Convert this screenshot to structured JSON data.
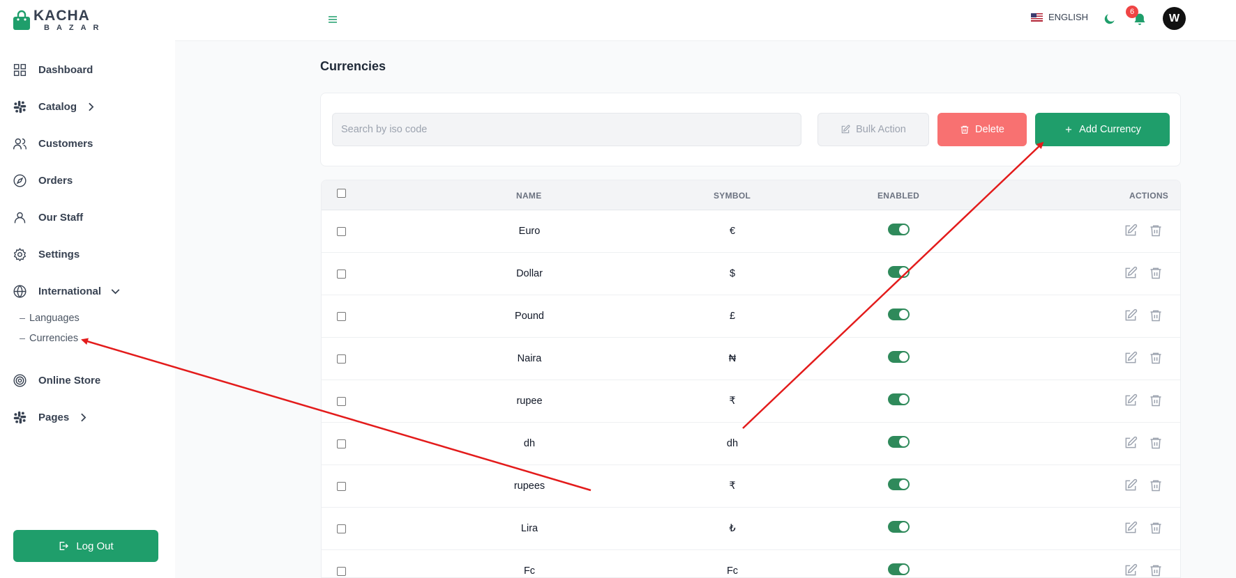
{
  "brand": {
    "top": "KACHA",
    "bottom": "BAZAR"
  },
  "sidebar": {
    "items": [
      {
        "label": "Dashboard",
        "icon": "grid-icon"
      },
      {
        "label": "Catalog",
        "icon": "slack-icon"
      },
      {
        "label": "Customers",
        "icon": "users-icon"
      },
      {
        "label": "Orders",
        "icon": "compass-icon"
      },
      {
        "label": "Our Staff",
        "icon": "user-icon"
      },
      {
        "label": "Settings",
        "icon": "gear-icon"
      },
      {
        "label": "International",
        "icon": "globe-icon"
      },
      {
        "label": "Online Store",
        "icon": "target-icon"
      },
      {
        "label": "Pages",
        "icon": "slack-icon"
      }
    ],
    "sub_items": [
      "Languages",
      "Currencies"
    ],
    "logout_label": "Log Out"
  },
  "header": {
    "language": "ENGLISH",
    "notification_count": "6",
    "avatar_initial": "W"
  },
  "page": {
    "title": "Currencies",
    "search_placeholder": "Search by iso code",
    "bulk_action_label": "Bulk Action",
    "delete_label": "Delete",
    "add_label": "Add Currency"
  },
  "table": {
    "columns": [
      "NAME",
      "SYMBOL",
      "ENABLED",
      "ACTIONS"
    ],
    "rows": [
      {
        "name": "Euro",
        "symbol": "€",
        "enabled": true
      },
      {
        "name": "Dollar",
        "symbol": "$",
        "enabled": true
      },
      {
        "name": "Pound",
        "symbol": "£",
        "enabled": true
      },
      {
        "name": "Naira",
        "symbol": "₦",
        "enabled": true
      },
      {
        "name": "rupee",
        "symbol": "₹",
        "enabled": true
      },
      {
        "name": "dh",
        "symbol": "dh",
        "enabled": true
      },
      {
        "name": "rupees",
        "symbol": "₹",
        "enabled": true
      },
      {
        "name": "Lira",
        "symbol": "₺",
        "enabled": true
      },
      {
        "name": "Fc",
        "symbol": "Fc",
        "enabled": true
      }
    ]
  },
  "colors": {
    "primary": "#1f9e6b",
    "danger": "#f87171",
    "annotation": "#e31b1b",
    "toggle_on": "#2f8a5b"
  }
}
